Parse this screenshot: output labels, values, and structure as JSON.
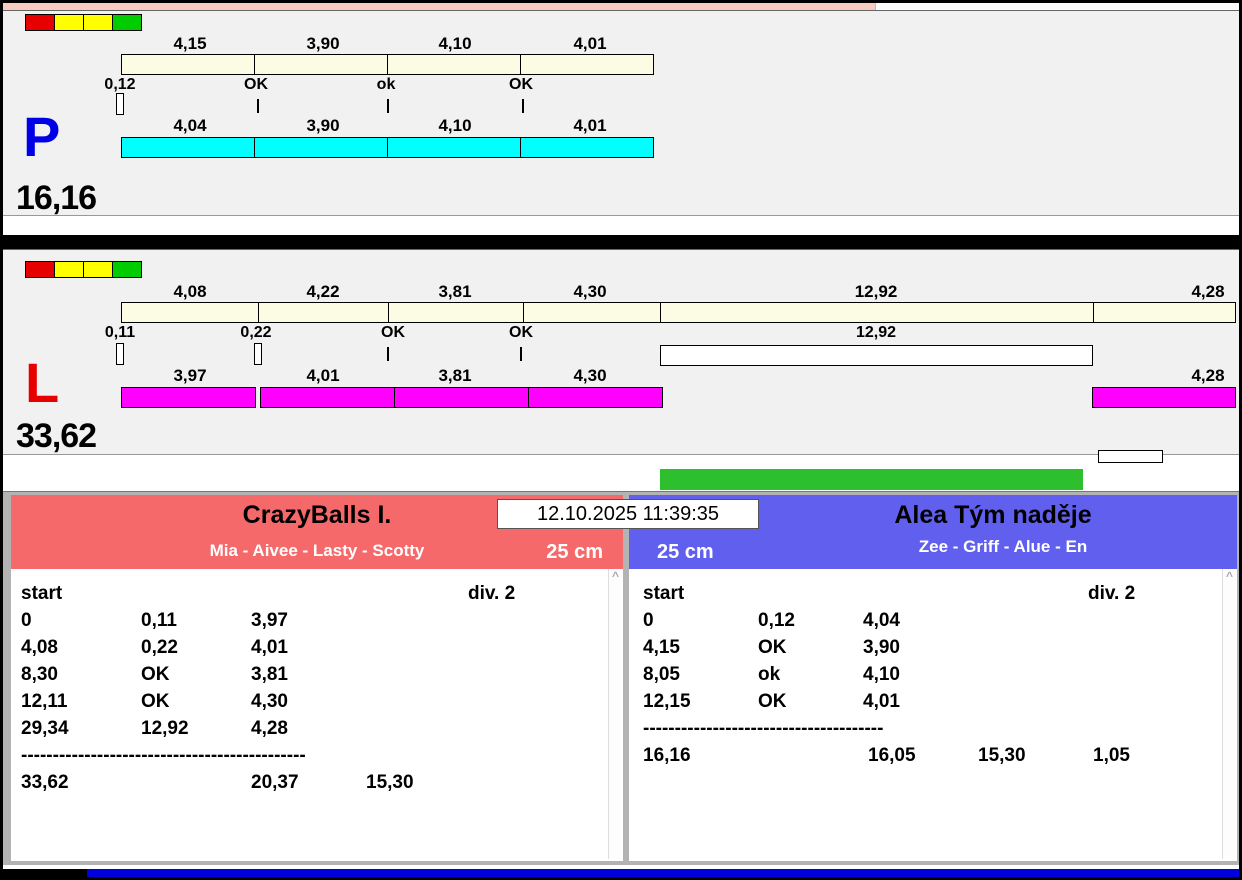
{
  "colors": {
    "light_red": "#e60000",
    "light_yellow": "#ffff00",
    "light_green": "#00cc00",
    "split_bar": "#fcfbe4",
    "lane_p_fill": "#00ffff",
    "lane_l_fill": "#ff00ff",
    "progress_green": "#2ebf2e",
    "team_left_header": "#f5696b",
    "team_right_header": "#6160ee",
    "lane_p_letter": "#0000e6",
    "lane_l_letter": "#e60000",
    "footer_bar": "#0000da"
  },
  "datetime": "12.10.2025 11:39:35",
  "lane_p": {
    "letter": "P",
    "total": "16,16",
    "top_labels": [
      "4,15",
      "3,90",
      "4,10",
      "4,01"
    ],
    "mid_labels": [
      "0,12",
      "OK",
      "ok",
      "OK"
    ],
    "bottom_labels": [
      "4,04",
      "3,90",
      "4,10",
      "4,01"
    ]
  },
  "lane_l": {
    "letter": "L",
    "total": "33,62",
    "top_labels": [
      "4,08",
      "4,22",
      "3,81",
      "4,30",
      "12,92",
      "4,28"
    ],
    "mid_labels": [
      "0,11",
      "0,22",
      "OK",
      "OK",
      "12,92"
    ],
    "bottom_labels": [
      "3,97",
      "4,01",
      "3,81",
      "4,30",
      "4,28"
    ]
  },
  "left_team": {
    "name": "CrazyBalls I.",
    "members": "Mia - Aivee - Lasty - Scotty",
    "height": "25 cm",
    "start_label": "start",
    "division": "div.  2",
    "rows": [
      [
        "0",
        "0,11",
        "3,97"
      ],
      [
        "4,08",
        "0,22",
        "4,01"
      ],
      [
        "8,30",
        "OK",
        "3,81"
      ],
      [
        "12,11",
        "OK",
        "4,30"
      ],
      [
        "29,34",
        "12,92",
        "4,28"
      ]
    ],
    "separator": "---------------------------------------------",
    "totals": [
      "33,62",
      "20,37",
      "15,30"
    ],
    "scroll_up": "^"
  },
  "right_team": {
    "name": "Alea Tým naděje",
    "members": "Zee - Griff - Alue - En",
    "height": "25 cm",
    "start_label": "start",
    "division": "div.  2",
    "rows": [
      [
        "0",
        "0,12",
        "4,04"
      ],
      [
        "4,15",
        "OK",
        "3,90"
      ],
      [
        "8,05",
        "ok",
        "4,10"
      ],
      [
        "12,15",
        "OK",
        "4,01"
      ]
    ],
    "separator": "--------------------------------------",
    "totals": [
      "16,16",
      "16,05",
      "15,30",
      "1,05"
    ],
    "scroll_up": "^"
  }
}
